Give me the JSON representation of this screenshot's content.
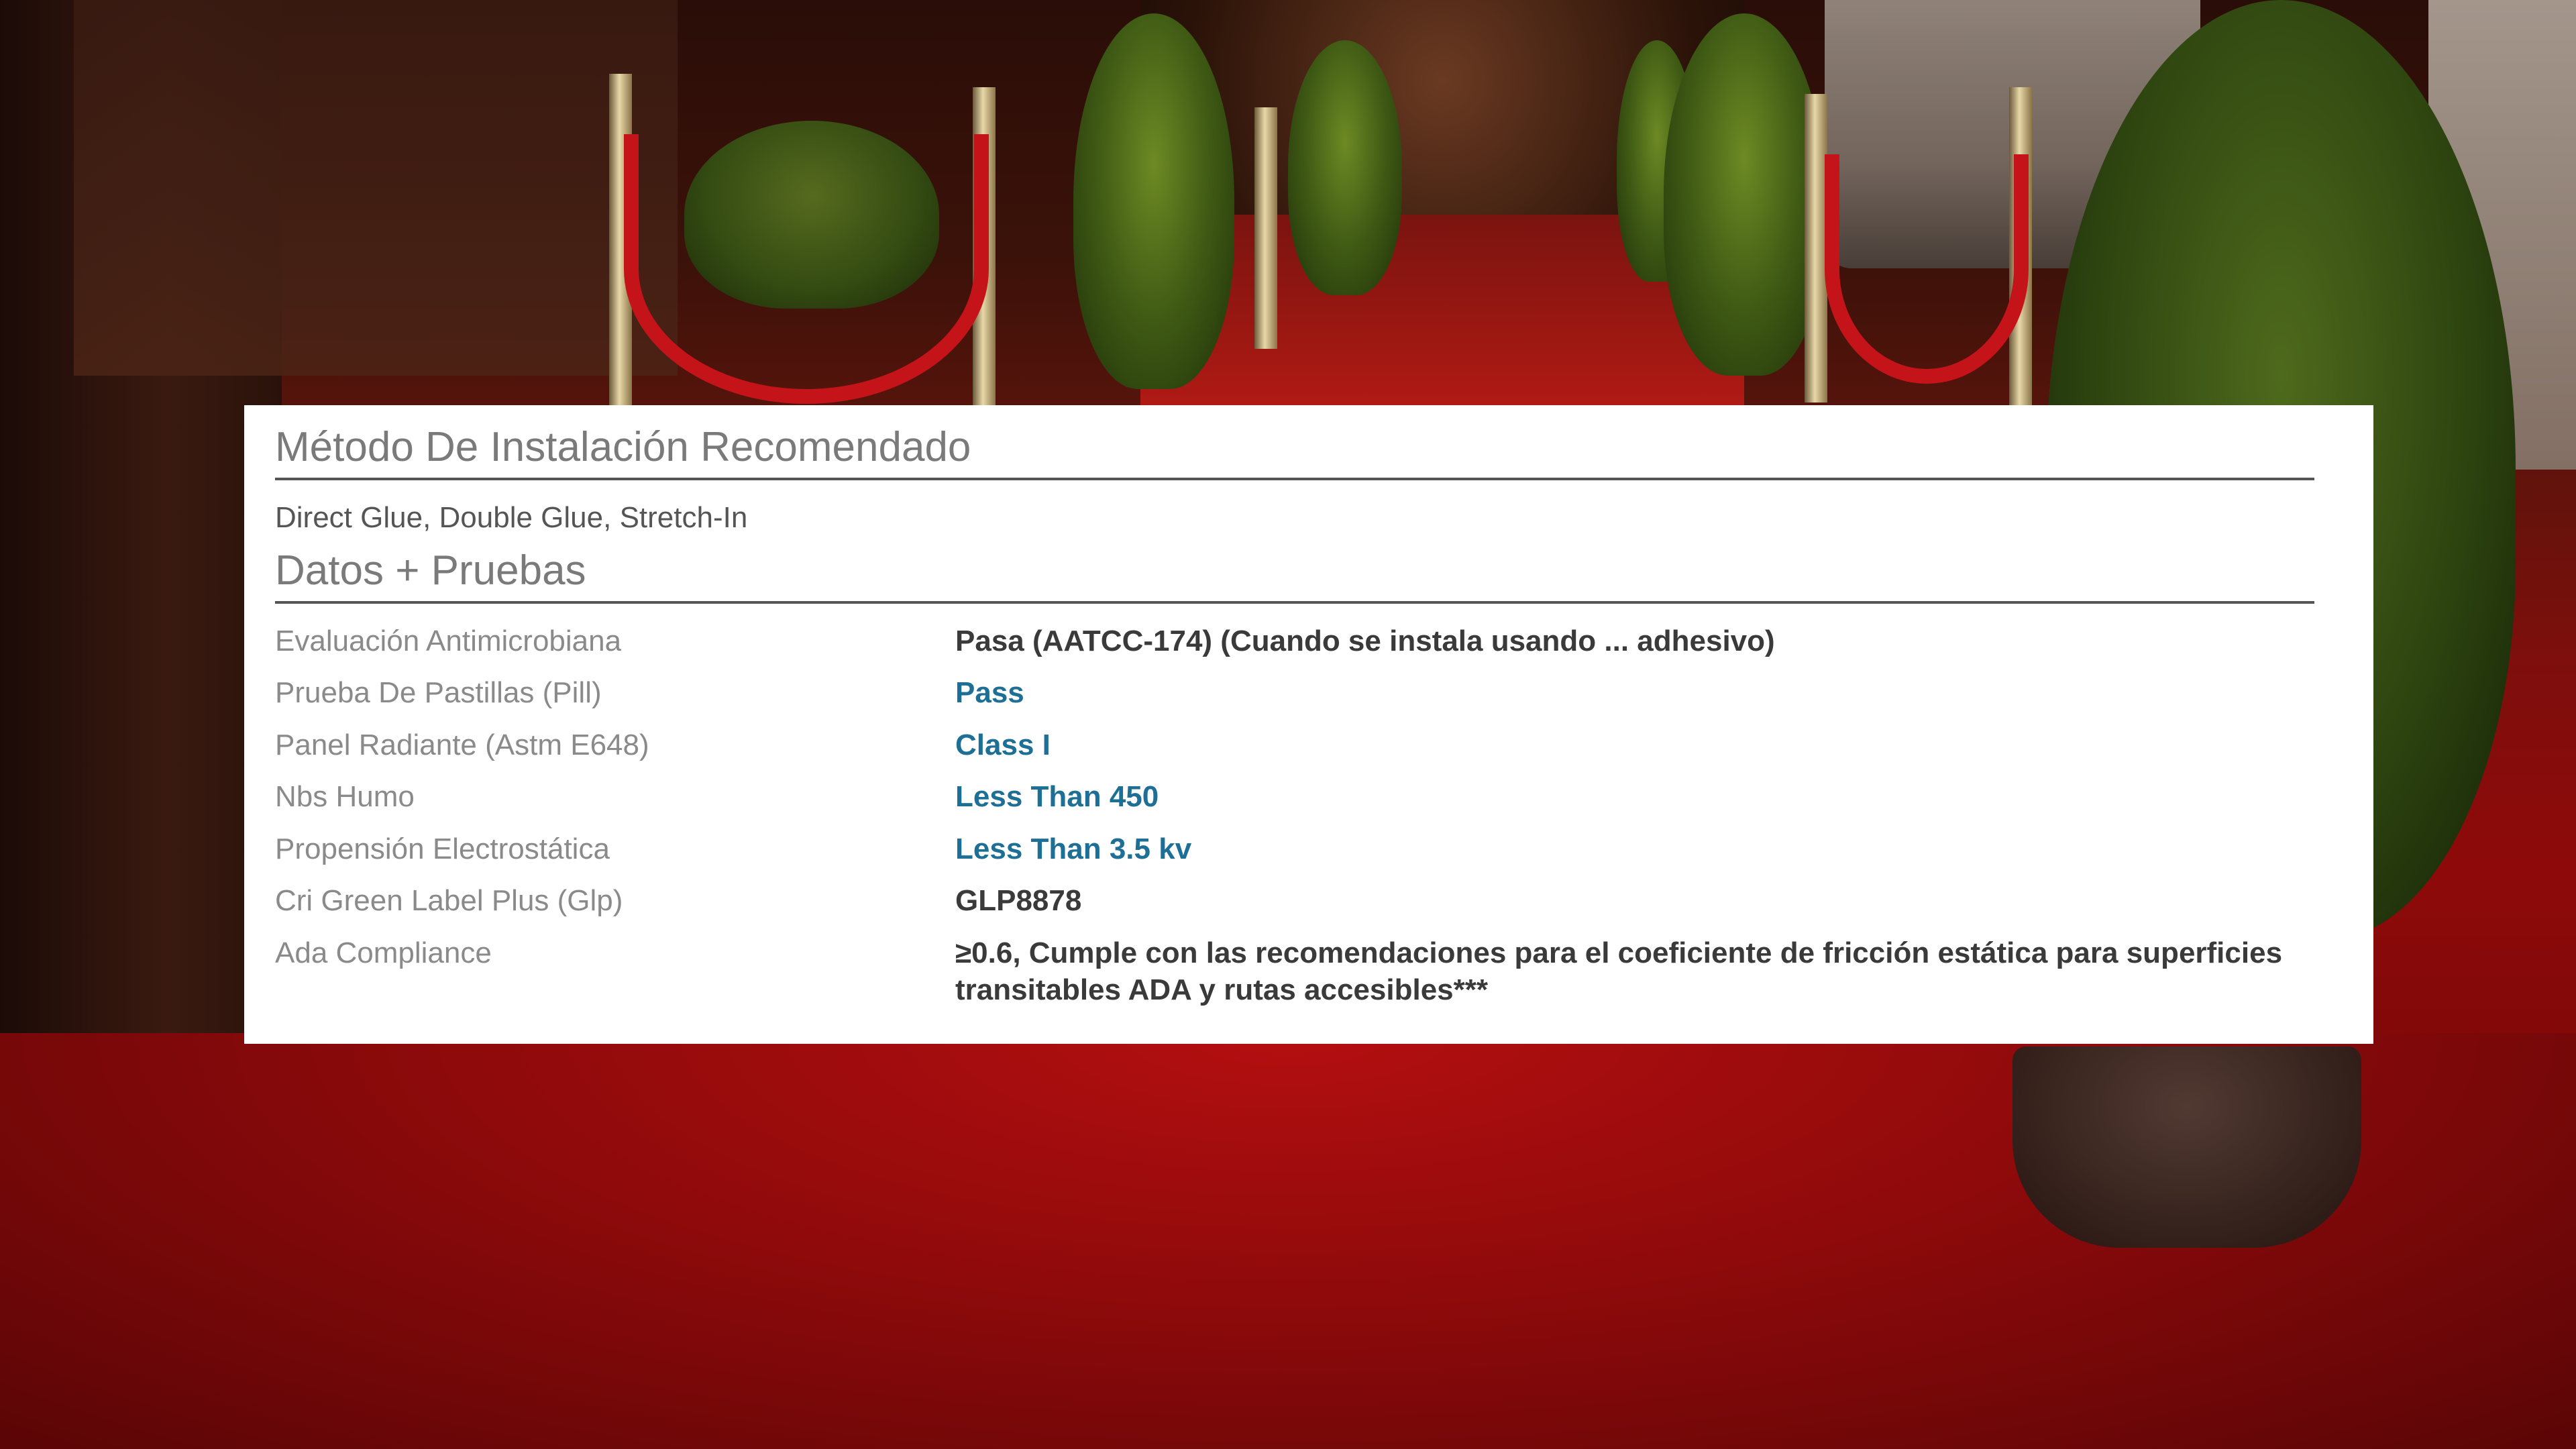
{
  "install": {
    "title": "Método De Instalación Recomendado",
    "methods": "Direct Glue, Double Glue, Stretch-In"
  },
  "data_tests": {
    "title": "Datos + Pruebas",
    "rows": [
      {
        "label": "Evaluación Antimicrobiana",
        "value": "Pasa (AATCC-174) (Cuando se instala usando ... adhesivo)"
      },
      {
        "label": "Prueba De Pastillas (Pill)",
        "value": "Pass"
      },
      {
        "label": "Panel Radiante (Astm E648)",
        "value": "Class I"
      },
      {
        "label": "Nbs Humo",
        "value": "Less Than 450"
      },
      {
        "label": "Propensión Electrostática",
        "value": "Less Than 3.5 kv"
      },
      {
        "label": "Cri Green Label Plus (Glp)",
        "value": "GLP8878"
      },
      {
        "label": "Ada Compliance",
        "value": "≥0.6, Cumple con las recomendaciones para el coeficiente de fricción estática para superficies transitables ADA y rutas accesibles***"
      }
    ]
  },
  "colors": {
    "link": "#1e6f96",
    "value_dark": "#3a3a3a",
    "label": "#8a8a8a",
    "title": "#7a7a7a"
  }
}
